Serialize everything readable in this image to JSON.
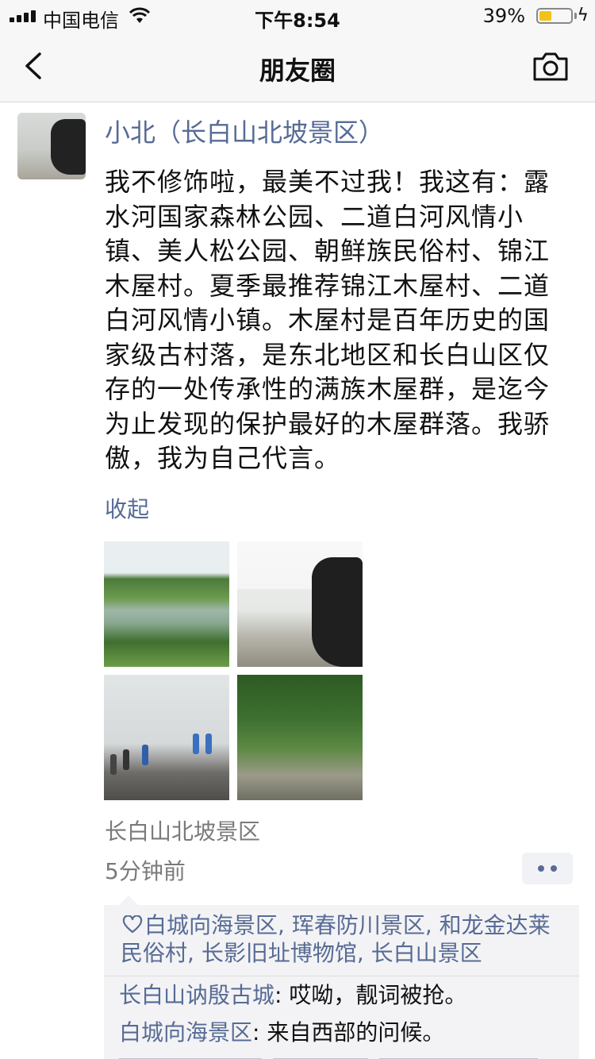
{
  "status_bar": {
    "carrier": "中国电信",
    "time": "下午8:54",
    "battery_percent": "39%",
    "battery_level": 0.39,
    "battery_color": "#f2c21a"
  },
  "nav": {
    "back_icon": "chevron-left-icon",
    "title": "朋友圈",
    "camera_icon": "camera-icon"
  },
  "post": {
    "author": "小北（长白山北坡景区）",
    "text": "我不修饰啦，最美不过我！我这有：露水河国家森林公园、二道白河风情小镇、美人松公园、朝鲜族民俗村、锦江木屋村。夏季最推荐锦江木屋村、二道白河风情小镇。木屋村是百年历史的国家级古村落，是东北地区和长白山区仅存的一处传承性的满族木屋群，是迄今为止发现的保护最好的木屋群落。我骄傲，我为自己代言。",
    "collapse_label": "收起",
    "location": "长白山北坡景区",
    "timestamp": "5分钟前",
    "more_icon": "more-dots-icon"
  },
  "likes": {
    "icon": "heart-icon",
    "names": [
      "白城向海景区",
      "珲春防川景区",
      "和龙金达莱民俗村",
      "长影旧址博物馆",
      "长白山景区"
    ],
    "separator": ", "
  },
  "comments": [
    {
      "author": "长白山讷殷古城",
      "text": ": 哎呦，靓词被抢。"
    },
    {
      "author": "白城向海景区",
      "text": ": 来自西部的问候。"
    }
  ],
  "colors": {
    "link": "#576b95",
    "bar_background": "#f7f7f7",
    "feedback_background": "#f3f3f5"
  }
}
